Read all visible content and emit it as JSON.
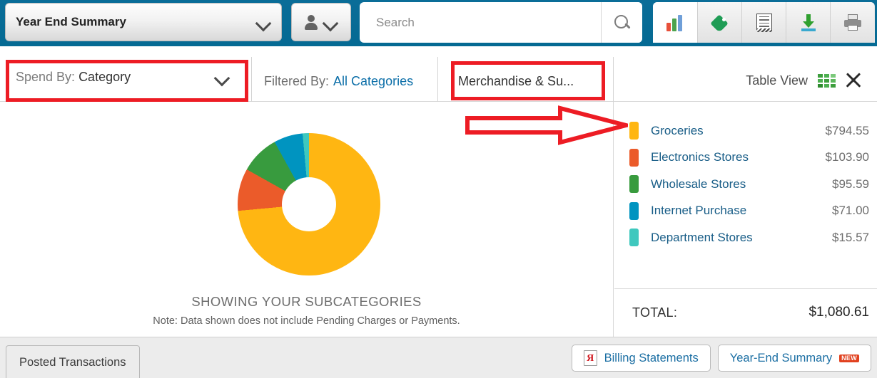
{
  "header": {
    "account_selector": {
      "label": "Year End Summary",
      "icon": "chevron-down-icon"
    },
    "user_menu": {
      "icon": "person-icon",
      "chevron": "chevron-down-icon"
    },
    "search": {
      "value": "",
      "placeholder": "Search",
      "button_icon": "search-icon"
    },
    "tools": [
      {
        "name": "spend-analysis",
        "icon": "bar-chart-icon",
        "active": true
      },
      {
        "name": "offers",
        "icon": "tag-icon",
        "active": false
      },
      {
        "name": "statements",
        "icon": "receipt-icon",
        "active": false
      },
      {
        "name": "download",
        "icon": "download-icon",
        "active": false
      },
      {
        "name": "print",
        "icon": "printer-icon",
        "active": false
      }
    ]
  },
  "filter_bar": {
    "spend_by_label": "Spend By:",
    "spend_by_value": "Category",
    "filtered_by_label": "Filtered By:",
    "filtered_by_value": "All Categories",
    "merchandise_tab": "Merchandise & Su...",
    "table_view_label": "Table View",
    "table_view_icon": "grid-icon",
    "close_icon": "close-icon"
  },
  "chart_data": {
    "type": "pie",
    "title": "SHOWING YOUR SUBCATEGORIES",
    "note": "Note: Data shown does not include Pending Charges or Payments.",
    "categories": [
      "Groceries",
      "Electronics Stores",
      "Wholesale Stores",
      "Internet Purchase",
      "Department Stores"
    ],
    "values": [
      794.55,
      103.9,
      95.59,
      71.0,
      15.57
    ],
    "value_labels": [
      "$794.55",
      "$103.90",
      "$95.59",
      "$71.00",
      "$15.57"
    ],
    "colors": [
      "#FFB612",
      "#EB5B2A",
      "#389B3E",
      "#0094C0",
      "#3FC8BE"
    ],
    "total_label": "TOTAL:",
    "total_value": "$1,080.61",
    "donut": true,
    "legend_position": "right"
  },
  "footer": {
    "tab_label": "Posted Transactions",
    "buttons": [
      {
        "label": "Billing Statements",
        "icon": "pdf-icon",
        "badge": ""
      },
      {
        "label": "Year-End Summary",
        "icon": "",
        "badge": "NEW"
      }
    ]
  },
  "annotations": {
    "color": "#ED1C24",
    "arrow_target": "Groceries legend row"
  },
  "theme": {
    "header_bg": "#056A93",
    "link_blue": "#185D87",
    "annotation_red": "#ED1C24"
  }
}
